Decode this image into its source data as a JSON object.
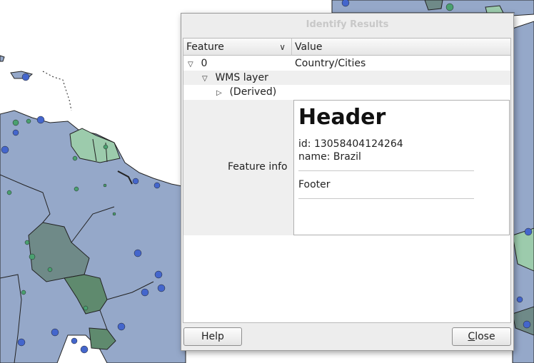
{
  "dialog": {
    "title": "Identify Results",
    "columns": {
      "feature": "Feature",
      "value": "Value"
    },
    "rows": [
      {
        "expander": "▽",
        "label": "0",
        "value": "Country/Cities"
      },
      {
        "expander": "▽",
        "label": "WMS layer",
        "value": ""
      },
      {
        "expander": "▷",
        "label": "(Derived)",
        "value": ""
      }
    ],
    "feature_info": {
      "label": "Feature info",
      "header": "Header",
      "id_line": "id: 13058404124264",
      "name_line": "name: Brazil",
      "footer": "Footer"
    },
    "buttons": {
      "help": "Help",
      "close_first": "C",
      "close_rest": "lose"
    }
  },
  "map": {
    "colors": {
      "country_blue": "#95a8c9",
      "country_green": "#9ccbac",
      "country_dark": "#6f8a88",
      "country_darkgreen": "#5f8a6e",
      "city_blue": "#4466cc",
      "city_green": "#4aa070",
      "border": "#222222"
    }
  }
}
